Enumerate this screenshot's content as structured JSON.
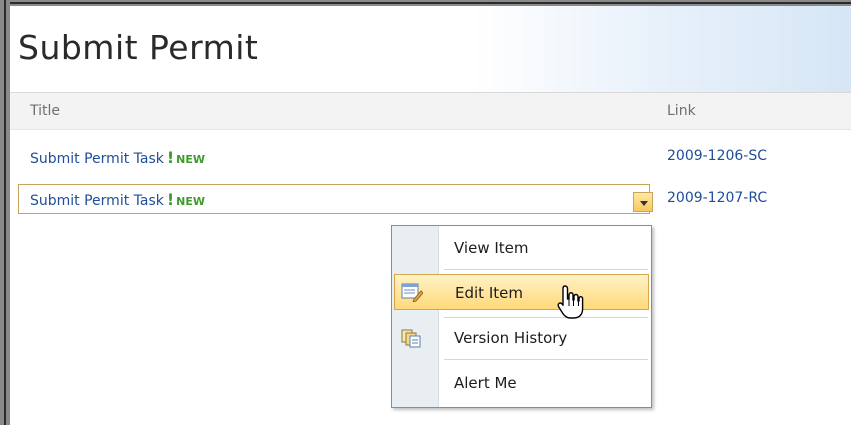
{
  "page": {
    "title": "Submit Permit"
  },
  "columns": {
    "title": "Title",
    "link": "Link"
  },
  "rows": [
    {
      "title": "Submit Permit Task",
      "alert": "!",
      "badge": "NEW",
      "link": "2009-1206-SC"
    },
    {
      "title": "Submit Permit Task",
      "alert": "!",
      "badge": "NEW",
      "link": "2009-1207-RC"
    }
  ],
  "context_menu": {
    "items": [
      {
        "label": "View Item",
        "icon": "none"
      },
      {
        "label": "Edit Item",
        "icon": "edit-item-icon",
        "highlighted": true
      },
      {
        "label": "Version History",
        "icon": "version-history-icon"
      },
      {
        "label": "Alert Me",
        "icon": "none"
      }
    ]
  },
  "colors": {
    "link": "#1f4e9a",
    "new_badge": "#3f9c2a",
    "highlight": "#ffd97a",
    "selected_border": "#c8a35a"
  }
}
